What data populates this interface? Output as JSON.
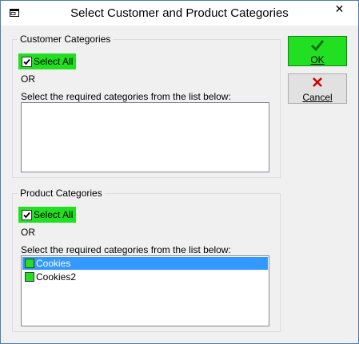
{
  "window": {
    "title": "Select Customer and Product Categories",
    "close_glyph": "✕"
  },
  "customer": {
    "group_label": "Customer Categories",
    "select_all_label": "Select All",
    "select_all_checked": true,
    "or_label": "OR",
    "instruction": "Select the required categories from the list below:",
    "items": []
  },
  "product": {
    "group_label": "Product Categories",
    "select_all_label": "Select All",
    "select_all_checked": true,
    "or_label": "OR",
    "instruction": "Select the required categories from the list below:",
    "items": [
      {
        "label": "Cookies",
        "checked": false,
        "selected": true
      },
      {
        "label": "Cookies2",
        "checked": false,
        "selected": false
      }
    ]
  },
  "buttons": {
    "ok_label": "OK",
    "cancel_label": "Cancel"
  },
  "colors": {
    "accent_green": "#21e021",
    "selection_blue": "#3399ff",
    "cancel_x_red": "#cc0000"
  }
}
